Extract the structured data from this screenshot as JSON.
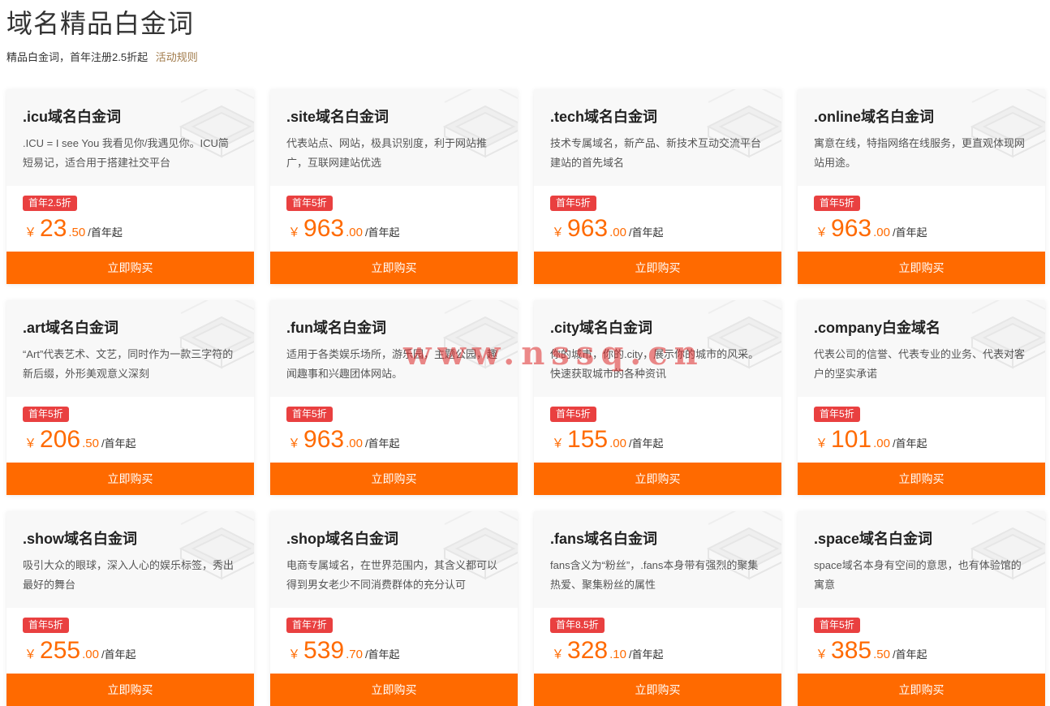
{
  "header": {
    "title": "域名精品白金词",
    "subtitle": "精品白金词，首年注册2.5折起",
    "rules_link": "活动规则"
  },
  "buy_label": "立即购买",
  "currency": "￥",
  "price_unit": "/首年起",
  "accent_color": "#ff6a00",
  "badge_color": "#e94040",
  "products": [
    {
      "name": ".icu域名白金词",
      "desc": ".ICU = I see You 我看见你/我遇见你。ICU简短易记，适合用于搭建社交平台",
      "badge": "首年2.5折",
      "price_int": "23",
      "price_dec": ".50"
    },
    {
      "name": ".site域名白金词",
      "desc": "代表站点、网站，极具识别度，利于网站推广，互联网建站优选",
      "badge": "首年5折",
      "price_int": "963",
      "price_dec": ".00"
    },
    {
      "name": ".tech域名白金词",
      "desc": "技术专属域名，新产品、新技术互动交流平台建站的首先域名",
      "badge": "首年5折",
      "price_int": "963",
      "price_dec": ".00"
    },
    {
      "name": ".online域名白金词",
      "desc": "寓意在线，特指网络在线服务，更直观体现网站用途。",
      "badge": "首年5折",
      "price_int": "963",
      "price_dec": ".00"
    },
    {
      "name": ".art域名白金词",
      "desc": "“Art”代表艺术、文艺，同时作为一款三字符的新后缀，外形美观意义深刻",
      "badge": "首年5折",
      "price_int": "206",
      "price_dec": ".50"
    },
    {
      "name": ".fun域名白金词",
      "desc": "适用于各类娱乐场所，游乐园，主题公园，趣闻趣事和兴趣团体网站。",
      "badge": "首年5折",
      "price_int": "963",
      "price_dec": ".00"
    },
    {
      "name": ".city域名白金词",
      "desc": "你的城市，你的.city，展示你的城市的风采。快速获取城市的各种资讯",
      "badge": "首年5折",
      "price_int": "155",
      "price_dec": ".00"
    },
    {
      "name": ".company白金域名",
      "desc": "代表公司的信誉、代表专业的业务、代表对客户的坚实承诺",
      "badge": "首年5折",
      "price_int": "101",
      "price_dec": ".00"
    },
    {
      "name": ".show域名白金词",
      "desc": "吸引大众的眼球，深入人心的娱乐标签，秀出最好的舞台",
      "badge": "首年5折",
      "price_int": "255",
      "price_dec": ".00"
    },
    {
      "name": ".shop域名白金词",
      "desc": "电商专属域名，在世界范围内，其含义都可以得到男女老少不同消费群体的充分认可",
      "badge": "首年7折",
      "price_int": "539",
      "price_dec": ".70"
    },
    {
      "name": ".fans域名白金词",
      "desc": "fans含义为“粉丝”，.fans本身带有强烈的聚集热爱、聚集粉丝的属性",
      "badge": "首年8.5折",
      "price_int": "328",
      "price_dec": ".10"
    },
    {
      "name": ".space域名白金词",
      "desc": "space域名本身有空间的意思，也有体验馆的寓意",
      "badge": "首年5折",
      "price_int": "385",
      "price_dec": ".50"
    }
  ],
  "watermark": "www.nssq.cn"
}
